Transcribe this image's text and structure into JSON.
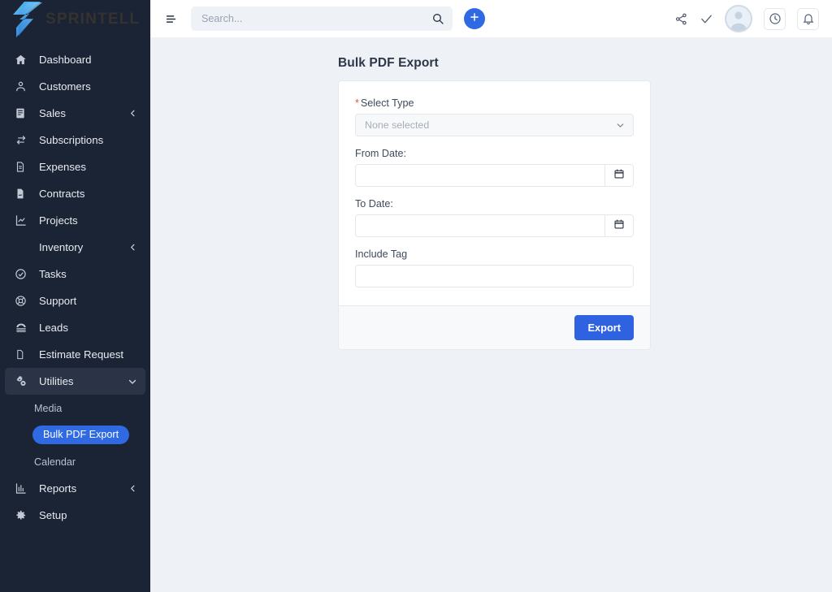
{
  "brand": {
    "name": "SPRINTELL",
    "logo_icon": "sprintell-logo-icon",
    "sidebar_bg": "#1b2435",
    "accent": "#2f6ae2"
  },
  "topbar": {
    "menu_toggle_icon": "hamburger-menu-icon",
    "search": {
      "value": "",
      "placeholder": "Search...",
      "icon": "search-icon"
    },
    "add_button_icon": "plus-icon",
    "actions": [
      {
        "name": "share-icon"
      },
      {
        "name": "check-icon"
      },
      {
        "name": "avatar"
      },
      {
        "name": "clock-icon"
      },
      {
        "name": "bell-icon"
      }
    ]
  },
  "sidebar": {
    "items": [
      {
        "label": "Dashboard",
        "icon": "home-icon",
        "has_icon": true,
        "chevron": "",
        "active": false
      },
      {
        "label": "Customers",
        "icon": "user-icon",
        "has_icon": true,
        "chevron": "",
        "active": false
      },
      {
        "label": "Sales",
        "icon": "receipt-icon",
        "has_icon": true,
        "chevron": "left",
        "active": false
      },
      {
        "label": "Subscriptions",
        "icon": "refresh-icon",
        "has_icon": true,
        "chevron": "",
        "active": false
      },
      {
        "label": "Expenses",
        "icon": "document-icon",
        "has_icon": true,
        "chevron": "",
        "active": false
      },
      {
        "label": "Contracts",
        "icon": "contract-icon",
        "has_icon": true,
        "chevron": "",
        "active": false
      },
      {
        "label": "Projects",
        "icon": "chart-icon",
        "has_icon": true,
        "chevron": "",
        "active": false
      },
      {
        "label": "Inventory",
        "icon": "missing-icon",
        "has_icon": false,
        "chevron": "left",
        "active": false
      },
      {
        "label": "Tasks",
        "icon": "check-circle-icon",
        "has_icon": true,
        "chevron": "",
        "active": false
      },
      {
        "label": "Support",
        "icon": "lifebuoy-icon",
        "has_icon": true,
        "chevron": "",
        "active": false
      },
      {
        "label": "Leads",
        "icon": "megaphone-icon",
        "has_icon": true,
        "chevron": "",
        "active": false
      },
      {
        "label": "Estimate Request",
        "icon": "file-icon",
        "has_icon": true,
        "chevron": "",
        "active": false
      },
      {
        "label": "Utilities",
        "icon": "gears-icon",
        "has_icon": true,
        "chevron": "down",
        "active": false,
        "expanded": true
      }
    ],
    "utilities_children": [
      {
        "label": "Media",
        "active": false
      },
      {
        "label": "Bulk PDF Export",
        "active": true
      },
      {
        "label": "Calendar",
        "active": false
      }
    ],
    "items_after": [
      {
        "label": "Reports",
        "icon": "bar-chart-icon",
        "has_icon": true,
        "chevron": "left",
        "active": false
      },
      {
        "label": "Setup",
        "icon": "gear-icon",
        "has_icon": true,
        "chevron": "",
        "active": false
      }
    ]
  },
  "page": {
    "title": "Bulk PDF Export",
    "form": {
      "select_type": {
        "label": "Select Type",
        "required_marker": "*",
        "value": "",
        "placeholder": "None selected",
        "chevron_icon": "chevron-down-icon"
      },
      "from_date": {
        "label": "From Date:",
        "value": "",
        "placeholder": "",
        "calendar_icon": "calendar-icon"
      },
      "to_date": {
        "label": "To Date:",
        "value": "",
        "placeholder": "",
        "calendar_icon": "calendar-icon"
      },
      "include_tag": {
        "label": "Include Tag",
        "value": "",
        "placeholder": ""
      }
    },
    "export_button": "Export"
  }
}
